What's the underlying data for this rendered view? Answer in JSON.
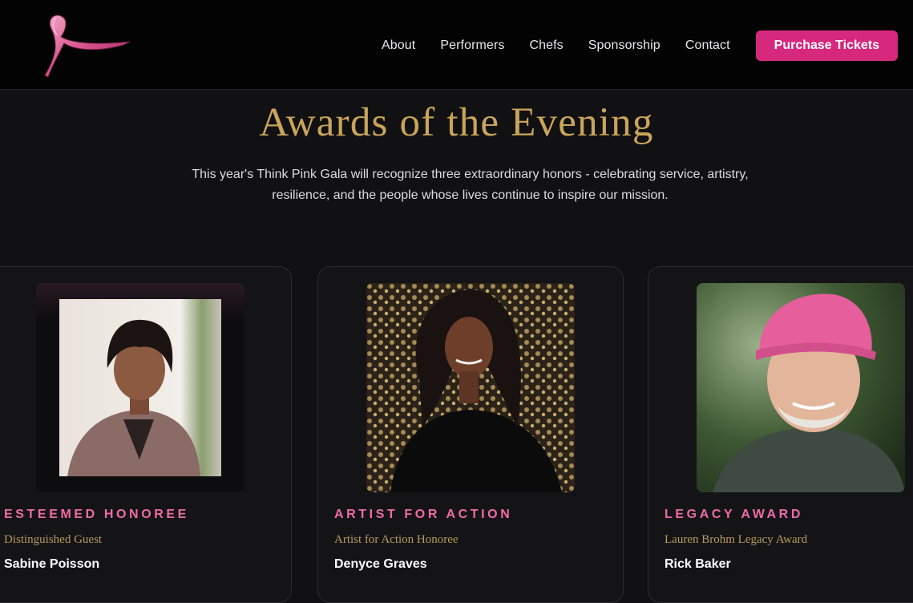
{
  "header": {
    "logo_icon": "pink-ribbon-icon",
    "nav": [
      {
        "label": "About"
      },
      {
        "label": "Performers"
      },
      {
        "label": "Chefs"
      },
      {
        "label": "Sponsorship"
      },
      {
        "label": "Contact"
      }
    ],
    "cta_label": "Purchase Tickets"
  },
  "section": {
    "title": "Awards of the Evening",
    "intro_line1": "This year's Think Pink Gala will recognize three extraordinary honors - celebrating service, artistry,",
    "intro_line2": "resilience, and the people whose lives continue to inspire our mission."
  },
  "awards": [
    {
      "role": "ESTEEMED HONOREE",
      "subtitle": "Distinguished Guest",
      "name": "Sabine Poisson"
    },
    {
      "role": "ARTIST FOR ACTION",
      "subtitle": "Artist for Action Honoree",
      "name": "Denyce Graves"
    },
    {
      "role": "LEGACY AWARD",
      "subtitle": "Lauren Brohm Legacy Award",
      "name": "Rick Baker"
    }
  ],
  "colors": {
    "accent": "#d6287d",
    "role_pink": "#f06aa8",
    "gold": "#c9a45a",
    "background": "#111113"
  }
}
